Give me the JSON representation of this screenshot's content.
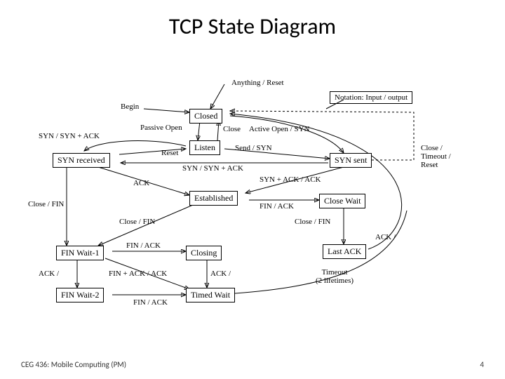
{
  "title": "TCP State Diagram",
  "footer": {
    "left": "CEG 436: Mobile Computing (PM)",
    "right": "4"
  },
  "diagram": {
    "notation": "Notation: Input / output",
    "states": {
      "closed": "Closed",
      "listen": "Listen",
      "syn_received": "SYN received",
      "syn_sent": "SYN sent",
      "established": "Established",
      "close_wait": "Close Wait",
      "fin_wait1": "FIN Wait-1",
      "closing": "Closing",
      "last_ack": "Last ACK",
      "fin_wait2": "FIN Wait-2",
      "timed_wait": "Timed Wait"
    },
    "transitions": {
      "anything_reset": "Anything / Reset",
      "begin": "Begin",
      "passive_open": "Passive Open",
      "close": "Close",
      "active_open_syn": "Active Open / SYN",
      "syn_syn_ack": "SYN / SYN + ACK",
      "reset": "Reset",
      "send_syn": "Send / SYN",
      "syn_syn_ack2": "SYN / SYN + ACK",
      "syn_ack_ack": "SYN + ACK / ACK",
      "ack": "ACK",
      "close_fin": "Close / FIN",
      "fin_ack": "FIN / ACK",
      "fin_ack2": "FIN / ACK",
      "close_fin2": "Close / FIN",
      "close_fin3": "Close / FIN",
      "ack_slash": "ACK /",
      "fin_ack_ack": "FIN + ACK / ACK",
      "ack_slash2": "ACK /",
      "ack_slash3": "ACK /",
      "fin_ack3": "FIN / ACK",
      "timeout_2life": "Timeout\n(2 lifetimes)",
      "close_timeout_reset": "Close /\nTimeout /\nReset"
    }
  }
}
